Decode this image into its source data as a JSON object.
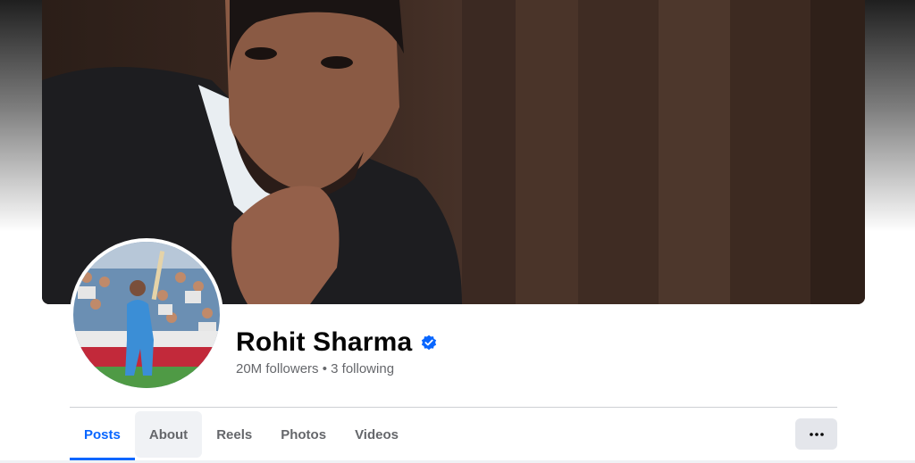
{
  "profile": {
    "name": "Rohit Sharma",
    "followers": "20M followers",
    "separator": "•",
    "following": "3 following",
    "verified_color": "#0866ff"
  },
  "tabs": [
    {
      "label": "Posts",
      "active": true
    },
    {
      "label": "About",
      "active": false
    },
    {
      "label": "Reels",
      "active": false
    },
    {
      "label": "Photos",
      "active": false
    },
    {
      "label": "Videos",
      "active": false
    }
  ],
  "icons": {
    "verified": "verified-badge-icon",
    "more": "more-options-icon"
  }
}
